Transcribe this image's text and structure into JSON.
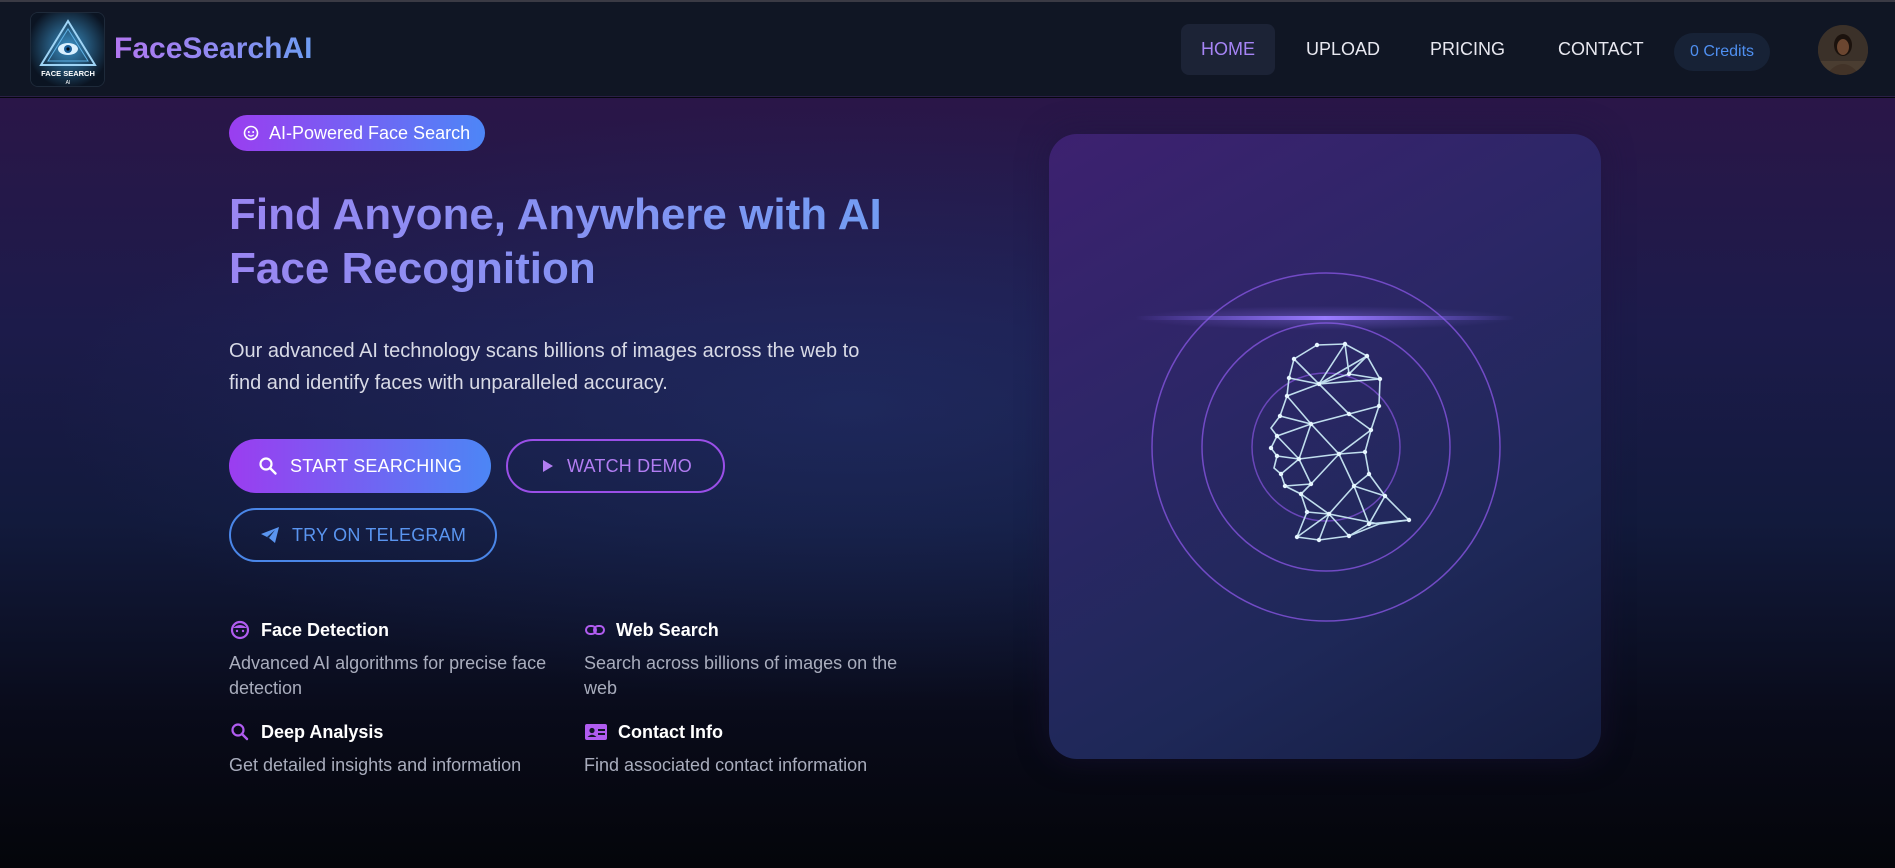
{
  "brand": {
    "name": "FaceSearchAI",
    "logo_text": "FACE SEARCH"
  },
  "nav": {
    "items": [
      {
        "label": "HOME",
        "active": true
      },
      {
        "label": "UPLOAD",
        "active": false
      },
      {
        "label": "PRICING",
        "active": false
      },
      {
        "label": "CONTACT",
        "active": false
      }
    ],
    "credits": "0 Credits"
  },
  "hero": {
    "badge": "AI-Powered Face Search",
    "headline_line1": "Find Anyone, Anywhere with AI",
    "headline_line2": "Face Recognition",
    "description_line1": "Our advanced AI technology scans billions of images across the web to",
    "description_line2": "find and identify faces with unparalleled accuracy.",
    "buttons": {
      "start": "START SEARCHING",
      "demo": "WATCH DEMO",
      "telegram": "TRY ON TELEGRAM"
    }
  },
  "features": [
    {
      "title": "Face Detection",
      "description_line1": "Advanced AI algorithms for precise face",
      "description_line2": "detection",
      "icon": "smiley-face-icon"
    },
    {
      "title": "Web Search",
      "description_line1": "Search across billions of images on the",
      "description_line2": "web",
      "icon": "link-icon"
    },
    {
      "title": "Deep Analysis",
      "description_line1": "Get detailed insights and information",
      "description_line2": "",
      "icon": "search-icon"
    },
    {
      "title": "Contact Info",
      "description_line1": "Find associated contact information",
      "description_line2": "",
      "icon": "contact-card-icon"
    }
  ],
  "colors": {
    "accent_purple": "#9b3df0",
    "accent_blue": "#4c86f5",
    "nav_active": "#a684f5",
    "credits_text": "#4f8ff0"
  }
}
